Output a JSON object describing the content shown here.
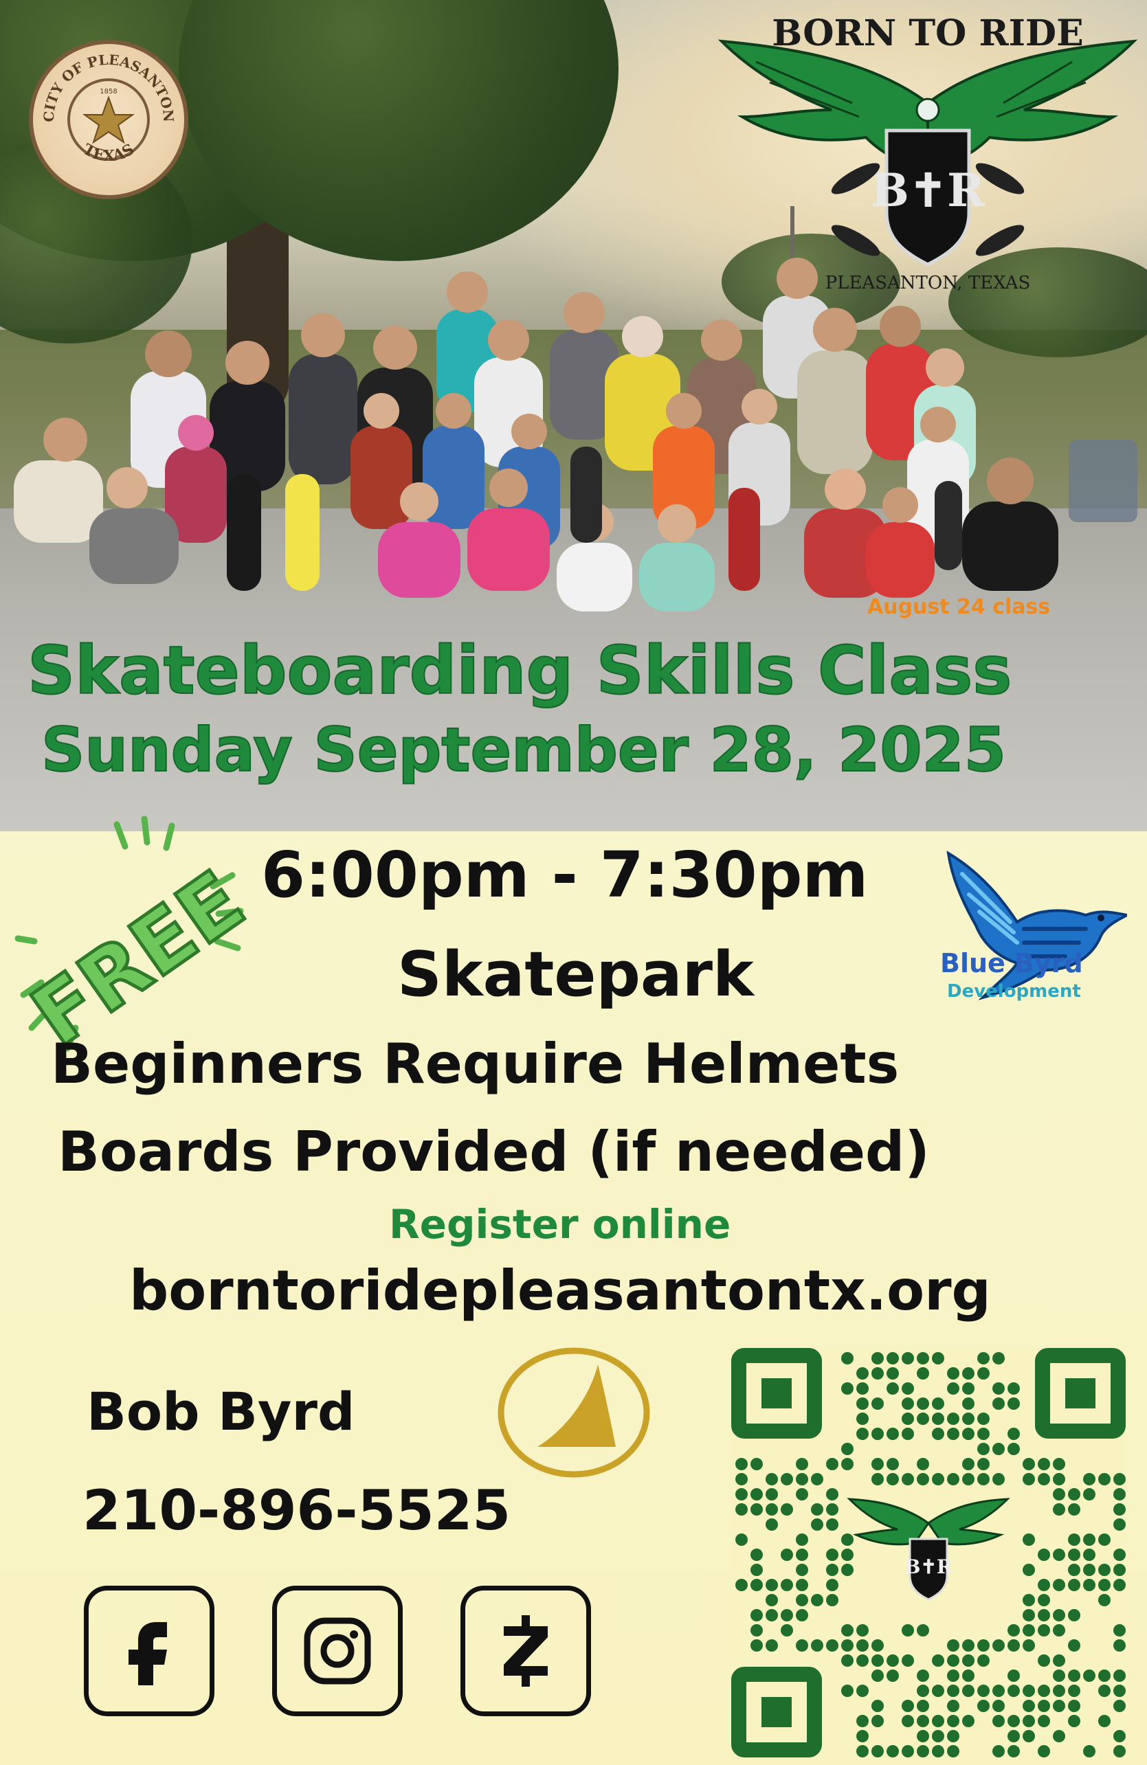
{
  "photo": {
    "caption": "August 24 class"
  },
  "seal": {
    "top_text": "CITY OF PLEASANTON",
    "year": "1858",
    "bottom_text": "TEXAS"
  },
  "brand": {
    "title": "BORN TO RIDE",
    "monogram": "B✝R",
    "location": "PLEASANTON, TEXAS",
    "color": "#1f8a3c"
  },
  "event": {
    "title": "Skateboarding Skills Class",
    "date": "Sunday September 28, 2025",
    "free_label": "FREE",
    "time": "6:00pm - 7:30pm",
    "location": "Skatepark",
    "requirement": "Beginners Require Helmets",
    "boards": "Boards Provided (if needed)",
    "register_label": "Register online",
    "website": "borntoridepleasantontx.org"
  },
  "sponsor": {
    "name": "Blue Byrd",
    "subtitle": "Development",
    "color": "#2a60c0"
  },
  "contact": {
    "name": "Bob Byrd",
    "phone": "210-896-5525"
  },
  "social": [
    {
      "icon": "facebook-icon"
    },
    {
      "icon": "instagram-icon"
    },
    {
      "icon": "zelle-icon"
    }
  ],
  "colors": {
    "headline_green": "#1f8a3c",
    "caption_orange": "#ee8a1f",
    "qr_green": "#1f6e2e",
    "gold": "#c9a227",
    "background": "#f8f5cc"
  }
}
